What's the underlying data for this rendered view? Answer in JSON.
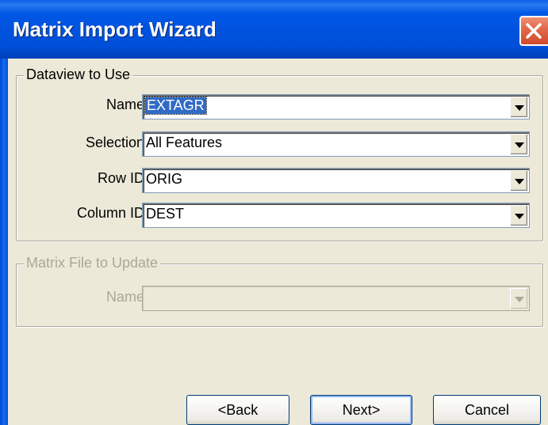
{
  "window": {
    "title": "Matrix Import Wizard"
  },
  "icons": {
    "close": "close-icon",
    "dropdown": "chevron-down-icon"
  },
  "dataview_group": {
    "label": "Dataview to Use",
    "fields": [
      {
        "label": "Name",
        "value": "EXTAGR",
        "selected": true
      },
      {
        "label": "Selection",
        "value": "All Features"
      },
      {
        "label": "Row ID",
        "value": "ORIG"
      },
      {
        "label": "Column ID",
        "value": "DEST"
      }
    ]
  },
  "matrix_group": {
    "label": "Matrix File to Update",
    "disabled": true,
    "fields": [
      {
        "label": "Name",
        "value": ""
      }
    ]
  },
  "buttons": {
    "back": "<Back",
    "next": "Next>",
    "cancel": "Cancel"
  },
  "colors": {
    "titlebar": "#0054E3",
    "face": "#ECE9D8",
    "selection": "#316AC5",
    "close": "#E16B4C"
  }
}
